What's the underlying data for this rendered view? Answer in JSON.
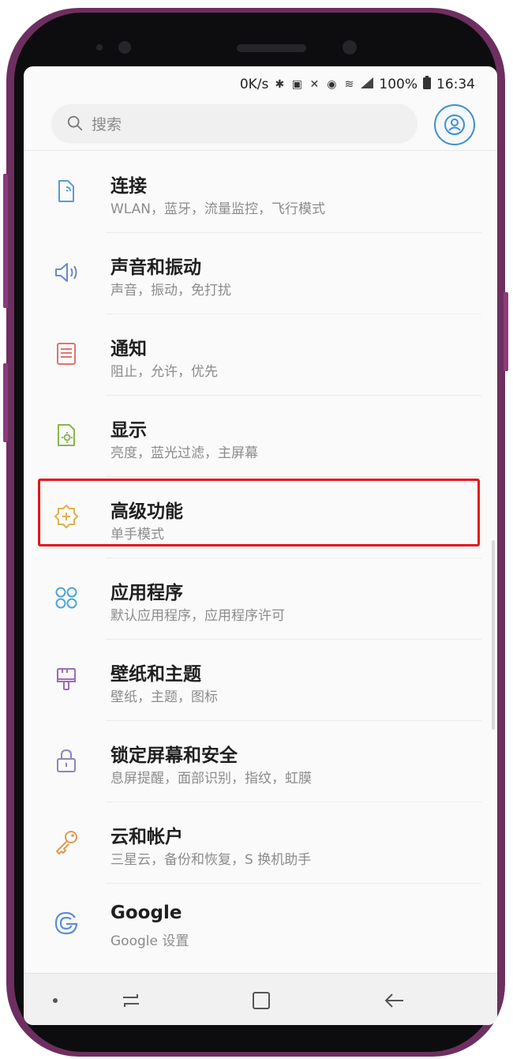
{
  "status_bar": {
    "net_speed": "0K/s",
    "battery": "100%",
    "time": "16:34"
  },
  "search": {
    "placeholder": "搜索"
  },
  "settings": [
    {
      "title": "连接",
      "subtitle": "WLAN，蓝牙，流量监控，飞行模式",
      "icon": "connection-icon",
      "color": "#5b9bd5"
    },
    {
      "title": "声音和振动",
      "subtitle": "声音，振动，免打扰",
      "icon": "sound-icon",
      "color": "#6a89c9"
    },
    {
      "title": "通知",
      "subtitle": "阻止，允许，优先",
      "icon": "notification-icon",
      "color": "#e2746b"
    },
    {
      "title": "显示",
      "subtitle": "亮度，蓝光过滤，主屏幕",
      "icon": "display-icon",
      "color": "#8ab44e"
    },
    {
      "title": "高级功能",
      "subtitle": "单手模式",
      "icon": "advanced-features-icon",
      "color": "#e2b04a"
    },
    {
      "title": "应用程序",
      "subtitle": "默认应用程序，应用程序许可",
      "icon": "apps-icon",
      "color": "#4aa7d8"
    },
    {
      "title": "壁纸和主题",
      "subtitle": "壁纸，主题，图标",
      "icon": "wallpaper-icon",
      "color": "#9a6db3"
    },
    {
      "title": "锁定屏幕和安全",
      "subtitle": "息屏提醒，面部识别，指纹，虹膜",
      "icon": "lock-icon",
      "color": "#8d86b8"
    },
    {
      "title": "云和帐户",
      "subtitle": "三星云，备份和恢复，S 换机助手",
      "icon": "key-icon",
      "color": "#e39a4e"
    },
    {
      "title": "Google",
      "subtitle": "Google 设置",
      "icon": "google-icon",
      "color": "#5b8fd8"
    }
  ],
  "highlight_color": "#e8121b"
}
